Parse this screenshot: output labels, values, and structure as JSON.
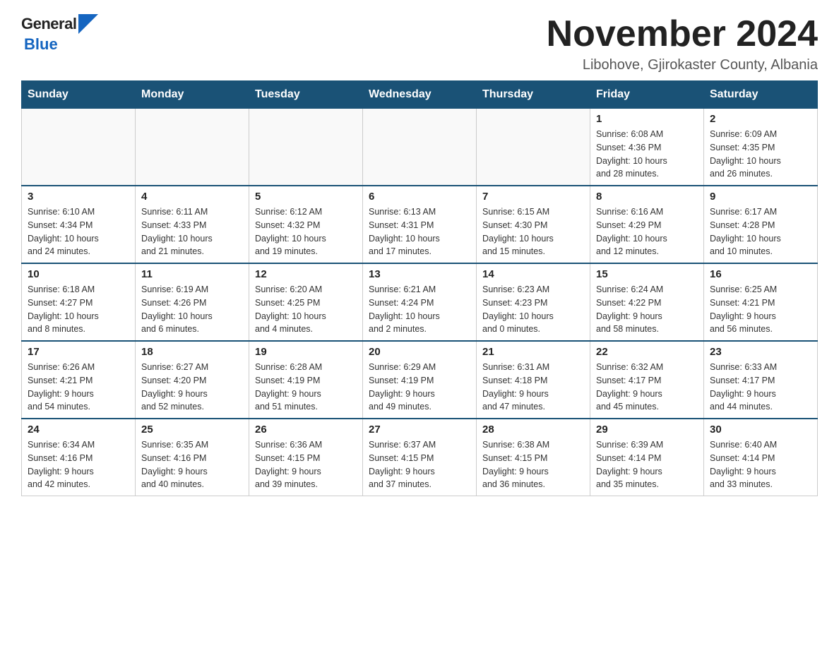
{
  "header": {
    "logo_general": "General",
    "logo_blue": "Blue",
    "month_title": "November 2024",
    "location": "Libohove, Gjirokaster County, Albania"
  },
  "days_of_week": [
    "Sunday",
    "Monday",
    "Tuesday",
    "Wednesday",
    "Thursday",
    "Friday",
    "Saturday"
  ],
  "weeks": [
    [
      {
        "day": "",
        "info": ""
      },
      {
        "day": "",
        "info": ""
      },
      {
        "day": "",
        "info": ""
      },
      {
        "day": "",
        "info": ""
      },
      {
        "day": "",
        "info": ""
      },
      {
        "day": "1",
        "info": "Sunrise: 6:08 AM\nSunset: 4:36 PM\nDaylight: 10 hours\nand 28 minutes."
      },
      {
        "day": "2",
        "info": "Sunrise: 6:09 AM\nSunset: 4:35 PM\nDaylight: 10 hours\nand 26 minutes."
      }
    ],
    [
      {
        "day": "3",
        "info": "Sunrise: 6:10 AM\nSunset: 4:34 PM\nDaylight: 10 hours\nand 24 minutes."
      },
      {
        "day": "4",
        "info": "Sunrise: 6:11 AM\nSunset: 4:33 PM\nDaylight: 10 hours\nand 21 minutes."
      },
      {
        "day": "5",
        "info": "Sunrise: 6:12 AM\nSunset: 4:32 PM\nDaylight: 10 hours\nand 19 minutes."
      },
      {
        "day": "6",
        "info": "Sunrise: 6:13 AM\nSunset: 4:31 PM\nDaylight: 10 hours\nand 17 minutes."
      },
      {
        "day": "7",
        "info": "Sunrise: 6:15 AM\nSunset: 4:30 PM\nDaylight: 10 hours\nand 15 minutes."
      },
      {
        "day": "8",
        "info": "Sunrise: 6:16 AM\nSunset: 4:29 PM\nDaylight: 10 hours\nand 12 minutes."
      },
      {
        "day": "9",
        "info": "Sunrise: 6:17 AM\nSunset: 4:28 PM\nDaylight: 10 hours\nand 10 minutes."
      }
    ],
    [
      {
        "day": "10",
        "info": "Sunrise: 6:18 AM\nSunset: 4:27 PM\nDaylight: 10 hours\nand 8 minutes."
      },
      {
        "day": "11",
        "info": "Sunrise: 6:19 AM\nSunset: 4:26 PM\nDaylight: 10 hours\nand 6 minutes."
      },
      {
        "day": "12",
        "info": "Sunrise: 6:20 AM\nSunset: 4:25 PM\nDaylight: 10 hours\nand 4 minutes."
      },
      {
        "day": "13",
        "info": "Sunrise: 6:21 AM\nSunset: 4:24 PM\nDaylight: 10 hours\nand 2 minutes."
      },
      {
        "day": "14",
        "info": "Sunrise: 6:23 AM\nSunset: 4:23 PM\nDaylight: 10 hours\nand 0 minutes."
      },
      {
        "day": "15",
        "info": "Sunrise: 6:24 AM\nSunset: 4:22 PM\nDaylight: 9 hours\nand 58 minutes."
      },
      {
        "day": "16",
        "info": "Sunrise: 6:25 AM\nSunset: 4:21 PM\nDaylight: 9 hours\nand 56 minutes."
      }
    ],
    [
      {
        "day": "17",
        "info": "Sunrise: 6:26 AM\nSunset: 4:21 PM\nDaylight: 9 hours\nand 54 minutes."
      },
      {
        "day": "18",
        "info": "Sunrise: 6:27 AM\nSunset: 4:20 PM\nDaylight: 9 hours\nand 52 minutes."
      },
      {
        "day": "19",
        "info": "Sunrise: 6:28 AM\nSunset: 4:19 PM\nDaylight: 9 hours\nand 51 minutes."
      },
      {
        "day": "20",
        "info": "Sunrise: 6:29 AM\nSunset: 4:19 PM\nDaylight: 9 hours\nand 49 minutes."
      },
      {
        "day": "21",
        "info": "Sunrise: 6:31 AM\nSunset: 4:18 PM\nDaylight: 9 hours\nand 47 minutes."
      },
      {
        "day": "22",
        "info": "Sunrise: 6:32 AM\nSunset: 4:17 PM\nDaylight: 9 hours\nand 45 minutes."
      },
      {
        "day": "23",
        "info": "Sunrise: 6:33 AM\nSunset: 4:17 PM\nDaylight: 9 hours\nand 44 minutes."
      }
    ],
    [
      {
        "day": "24",
        "info": "Sunrise: 6:34 AM\nSunset: 4:16 PM\nDaylight: 9 hours\nand 42 minutes."
      },
      {
        "day": "25",
        "info": "Sunrise: 6:35 AM\nSunset: 4:16 PM\nDaylight: 9 hours\nand 40 minutes."
      },
      {
        "day": "26",
        "info": "Sunrise: 6:36 AM\nSunset: 4:15 PM\nDaylight: 9 hours\nand 39 minutes."
      },
      {
        "day": "27",
        "info": "Sunrise: 6:37 AM\nSunset: 4:15 PM\nDaylight: 9 hours\nand 37 minutes."
      },
      {
        "day": "28",
        "info": "Sunrise: 6:38 AM\nSunset: 4:15 PM\nDaylight: 9 hours\nand 36 minutes."
      },
      {
        "day": "29",
        "info": "Sunrise: 6:39 AM\nSunset: 4:14 PM\nDaylight: 9 hours\nand 35 minutes."
      },
      {
        "day": "30",
        "info": "Sunrise: 6:40 AM\nSunset: 4:14 PM\nDaylight: 9 hours\nand 33 minutes."
      }
    ]
  ]
}
